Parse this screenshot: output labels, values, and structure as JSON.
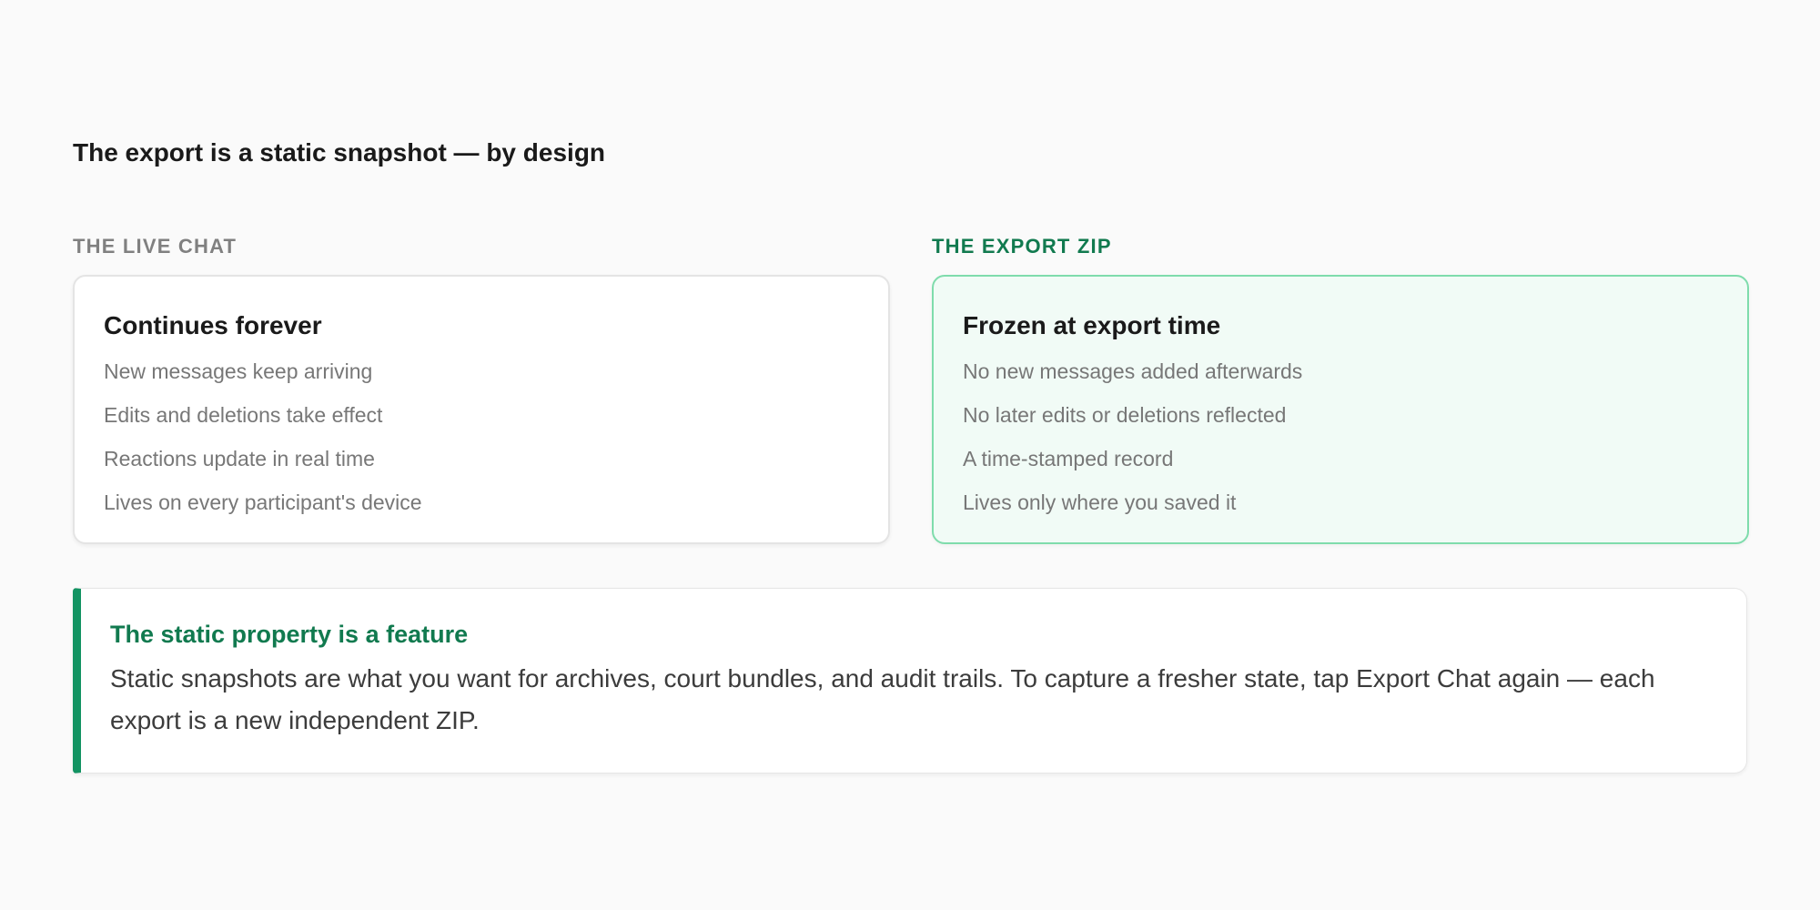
{
  "page": {
    "title": "The export is a static snapshot — by design"
  },
  "live_chat": {
    "label": "THE LIVE CHAT",
    "card_title": "Continues forever",
    "items": [
      "New messages keep arriving",
      "Edits and deletions take effect",
      "Reactions update in real time",
      "Lives on every participant's device"
    ]
  },
  "export_zip": {
    "label": "THE EXPORT ZIP",
    "card_title": "Frozen at export time",
    "items": [
      "No new messages added afterwards",
      "No later edits or deletions reflected",
      "A time-stamped record",
      "Lives only where you saved it"
    ]
  },
  "callout": {
    "title": "The static property is a feature",
    "body": "Static snapshots are what you want for archives, court bundles, and audit trails. To capture a fresher state, tap Export Chat again — each export is a new independent ZIP."
  },
  "colors": {
    "accent": "#129362",
    "accent_text": "#117a4f",
    "export_card_bg": "#f1fbf6",
    "export_card_border": "#7fdcac",
    "page_bg": "#fafafa"
  }
}
